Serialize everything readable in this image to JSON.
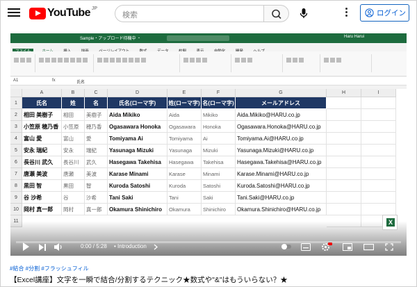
{
  "header": {
    "logo_text": "YouTube",
    "logo_region": "JP",
    "search_placeholder": "検索",
    "login_label": "ログイン"
  },
  "excel": {
    "window_title": "Sample・アップロード待機中 ・",
    "user_name": "Haru Harui",
    "tabs": [
      "ファイル",
      "ホーム",
      "挿入",
      "描画",
      "ページレイアウト",
      "数式",
      "データ",
      "校閲",
      "表示",
      "自動化",
      "開発",
      "ヘルプ"
    ],
    "active_tab": "ホーム",
    "name_box": "A1",
    "formula_value": "氏名",
    "columns": [
      "A",
      "B",
      "C",
      "D",
      "E",
      "F",
      "G",
      "H",
      "I"
    ],
    "rows": [
      "1",
      "2",
      "3",
      "4",
      "5",
      "6",
      "7",
      "8",
      "9",
      "10",
      "11"
    ],
    "table_headers": [
      "氏名",
      "姓",
      "名",
      "氏名(ローマ字)",
      "姓(ローマ字)",
      "名(ローマ字)",
      "メールアドレス"
    ],
    "table_rows": [
      [
        "相田 美樹子",
        "相田",
        "美樹子",
        "Aida Mikiko",
        "Aida",
        "Mikiko",
        "Aida.Mikiko@HARU.co.jp"
      ],
      [
        "小笠原 穂乃香",
        "小笠原",
        "穂乃香",
        "Ogasawara Honoka",
        "Ogasawara",
        "Honoka",
        "Ogasawara.Honoka@HARU.co.jp"
      ],
      [
        "富山 愛",
        "富山",
        "愛",
        "Tomiyama Ai",
        "Tomiyama",
        "Ai",
        "Tomiyama.Ai@HARU.co.jp"
      ],
      [
        "安永 瑞紀",
        "安永",
        "瑞紀",
        "Yasunaga Mizuki",
        "Yasunaga",
        "Mizuki",
        "Yasunaga.Mizuki@HARU.co.jp"
      ],
      [
        "長谷川 武久",
        "長谷川",
        "武久",
        "Hasegawa Takehisa",
        "Hasegawa",
        "Takehisa",
        "Hasegawa.Takehisa@HARU.co.jp"
      ],
      [
        "唐瀬 美波",
        "唐瀬",
        "美波",
        "Karase Minami",
        "Karase",
        "Minami",
        "Karase.Minami@HARU.co.jp"
      ],
      [
        "黒田 智",
        "黒田",
        "智",
        "Kuroda Satoshi",
        "Kuroda",
        "Satoshi",
        "Kuroda.Satoshi@HARU.co.jp"
      ],
      [
        "谷 沙希",
        "谷",
        "沙希",
        "Tani Saki",
        "Tani",
        "Saki",
        "Tani.Saki@HARU.co.jp"
      ],
      [
        "岡村 真一郎",
        "岡村",
        "真一郎",
        "Okamura Shinichiro",
        "Okamura",
        "Shinichiro",
        "Okamura.Shinichiro@HARU.co.jp"
      ]
    ]
  },
  "player": {
    "time": "0:00 / 5:28",
    "chapter": "• Introduction",
    "progress": 0
  },
  "video": {
    "hashtags": "#結合 #分割 #フラッシュフィル",
    "title": "【Excel講座】文字を一瞬で結合/分割するテクニック★数式や\"&\"はもういらない？★"
  },
  "colors": {
    "excel_green": "#1d6b3e",
    "table_header": "#1f3864",
    "yt_red": "#ff0000",
    "link_blue": "#065fd4"
  }
}
